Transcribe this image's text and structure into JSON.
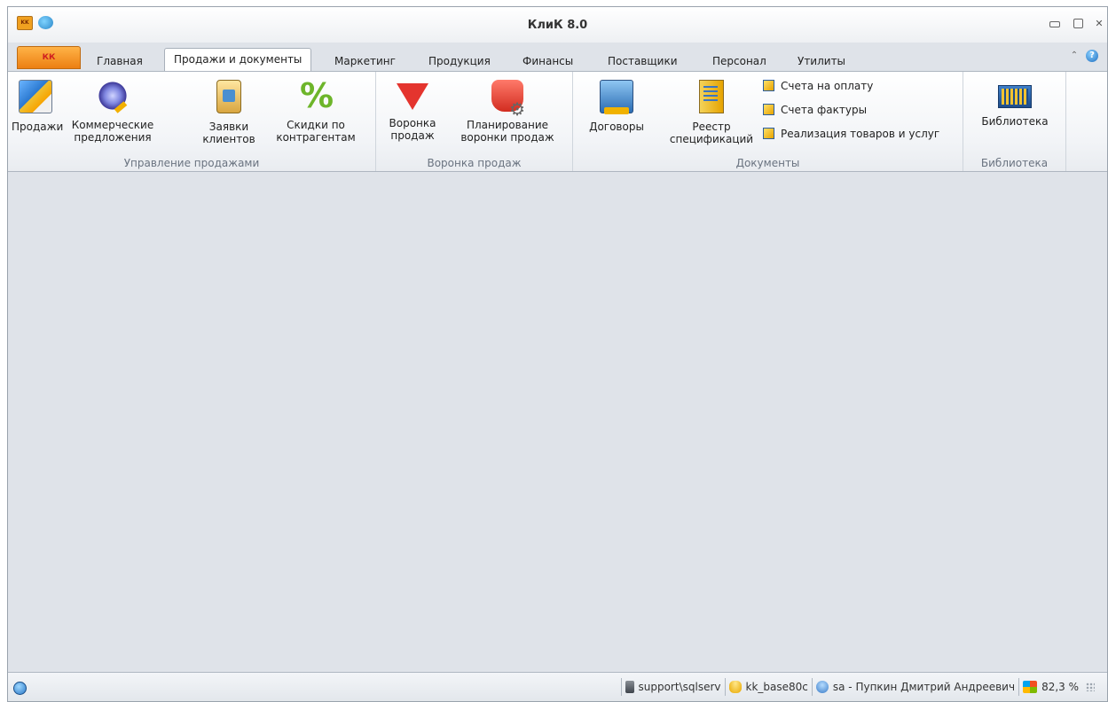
{
  "window": {
    "title": "КлиК 8.0"
  },
  "titlebar_controls": {
    "minimize": "",
    "maximize": "",
    "close": "✕"
  },
  "tabs": {
    "app_menu_label": "КК",
    "items": [
      {
        "label": "Главная"
      },
      {
        "label": "Продажи и документы",
        "active": true
      },
      {
        "label": "Маркетинг"
      },
      {
        "label": "Продукция"
      },
      {
        "label": "Финансы"
      },
      {
        "label": "Поставщики"
      },
      {
        "label": "Персонал"
      },
      {
        "label": "Утилиты"
      }
    ]
  },
  "ribbon": {
    "groups": [
      {
        "label": "Управление продажами",
        "buttons": [
          {
            "label": "Продажи",
            "icon": "sales-chart-icon"
          },
          {
            "label": "Коммерческие\nпредложения",
            "icon": "commercial-offer-icon"
          },
          {
            "label": "Заявки\nклиентов",
            "icon": "clipboard-icon"
          },
          {
            "label": "Скидки по\nконтрагентам",
            "icon": "percent-icon"
          }
        ]
      },
      {
        "label": "Воронка продаж",
        "buttons": [
          {
            "label": "Воронка\nпродаж",
            "icon": "funnel-icon"
          },
          {
            "label": "Планирование\nворонки продаж",
            "icon": "funnel-gear-icon"
          }
        ]
      },
      {
        "label": "Документы",
        "buttons": [
          {
            "label": "Договоры",
            "icon": "contract-icon"
          },
          {
            "label": "Реестр\nспецификаций",
            "icon": "specification-icon"
          }
        ],
        "small_buttons": [
          {
            "label": "Счета на оплату",
            "icon": "document-icon"
          },
          {
            "label": "Счета фактуры",
            "icon": "document-icon"
          },
          {
            "label": "Реализация товаров и услуг",
            "icon": "document-icon"
          }
        ]
      },
      {
        "label": "Библиотека",
        "buttons": [
          {
            "label": "Библиотека",
            "icon": "library-icon"
          }
        ]
      }
    ]
  },
  "statusbar": {
    "server": "support\\sqlserv",
    "database": "kk_base80c",
    "user": "sa - Пупкин Дмитрий Андреевич",
    "zoom": "82,3 %"
  }
}
